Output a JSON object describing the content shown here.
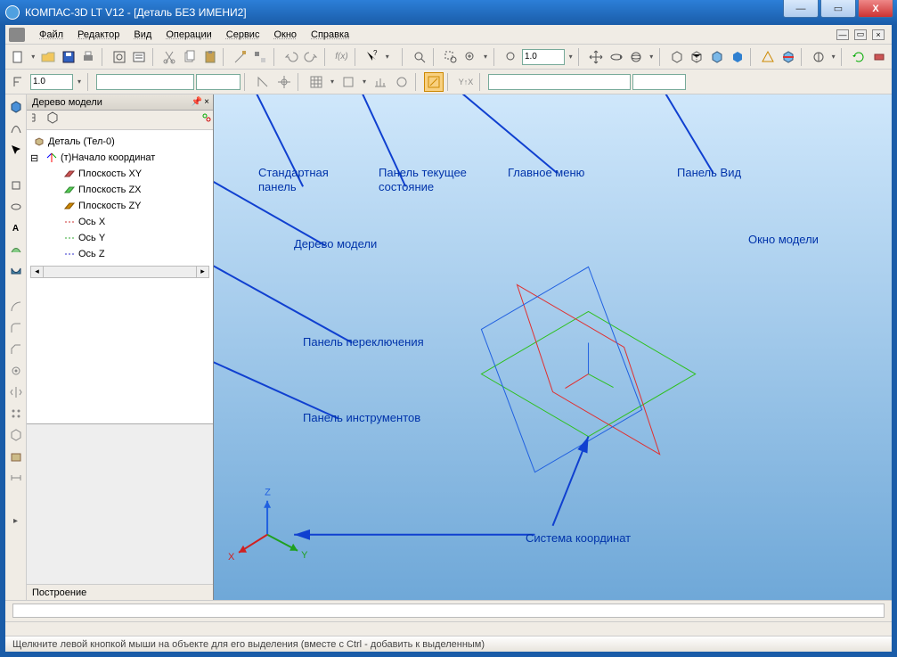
{
  "window": {
    "title": "КОМПАС-3D LT V12 - [Деталь БЕЗ ИМЕНИ2]",
    "min_label": "—",
    "max_label": "▭",
    "close_label": "X"
  },
  "menu": {
    "items": [
      "Файл",
      "Редактор",
      "Вид",
      "Операции",
      "Сервис",
      "Окно",
      "Справка"
    ]
  },
  "toolbar1": {
    "zoom_value": "1.0"
  },
  "toolbar2": {
    "step_value": "1.0"
  },
  "tree": {
    "title": "Дерево модели",
    "root": "Деталь (Тел-0)",
    "origin": "(т)Начало координат",
    "planes": [
      "Плоскость XY",
      "Плоскость ZX",
      "Плоскость ZY"
    ],
    "axes": [
      "Ось X",
      "Ось Y",
      "Ось Z"
    ],
    "status": "Построение"
  },
  "annotations": {
    "standard_panel": "Стандартная панель",
    "state_panel": "Панель текущее состояние",
    "main_menu": "Главное меню",
    "view_panel": "Панель Вид",
    "model_window": "Окно модели",
    "model_tree": "Дерево модели",
    "switch_panel": "Панель переключения",
    "tools_panel": "Панель инструментов",
    "coord_system": "Система координат",
    "axis_x": "X",
    "axis_y": "Y",
    "axis_z": "Z"
  },
  "statusbar": {
    "text": "Щелкните левой кнопкой мыши на объекте для его выделения (вместе с Ctrl - добавить к выделенным)"
  },
  "colors": {
    "arrow": "#1040d0",
    "text": "#0033aa"
  }
}
